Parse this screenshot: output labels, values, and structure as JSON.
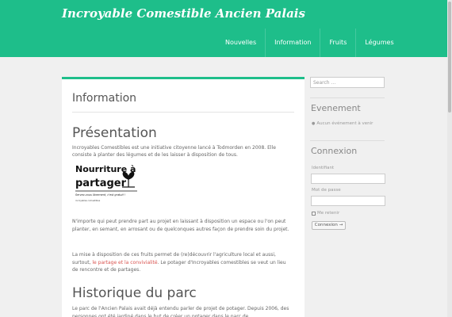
{
  "header": {
    "site_title": "Incroyable Comestible Ancien Palais",
    "nav": [
      "Nouvelles",
      "Information",
      "Fruits",
      "Légumes"
    ]
  },
  "main": {
    "page_title": "Information",
    "section1_title": "Présentation",
    "para1": "Incroyables Comestibles est une initiative citoyenne lancé à Todmorden en 2008. Elle consiste à planter des légumes et de les laisser à disposition de tous.",
    "logo": {
      "line1": "Nourriture à",
      "line2": "partager",
      "small": "Servez-vous librement, c'est gratuit !",
      "tiny": "incroyables comestibles"
    },
    "para2": "N'importe qui peut prendre part au projet en laissant à disposition un espace ou l'on peut planter, en semant, en arrosant ou de quelconques autres façon de prendre soin du projet.",
    "para3_start": "La mise à disposition de ces fruits permet de (re)découvrir l'agriculture local et aussi, surtout, ",
    "para3_highlight": "le partage et la convivialité",
    "para3_end": ". Le potager d'Incroyables comestibles se veut un lieu de rencontre et de partages.",
    "section2_title": "Historique du parc",
    "para4": "Le parc de l'Ancien Palais avait déjà entendu parler de projet de potager. Depuis 2006, des personnes ont été jardiné dans le but de créer un potager dans le parc de"
  },
  "sidebar": {
    "search_placeholder": "Search ...",
    "events_title": "Evenement",
    "events_empty": "Aucun événement à venir",
    "login_title": "Connexion",
    "identifiant_label": "Identifiant",
    "password_label": "Mot de passe",
    "remember_label": "Me retenir",
    "login_button": "Connexion →"
  },
  "colors": {
    "brand": "#1ebe8a",
    "highlight": "#d9534f"
  }
}
